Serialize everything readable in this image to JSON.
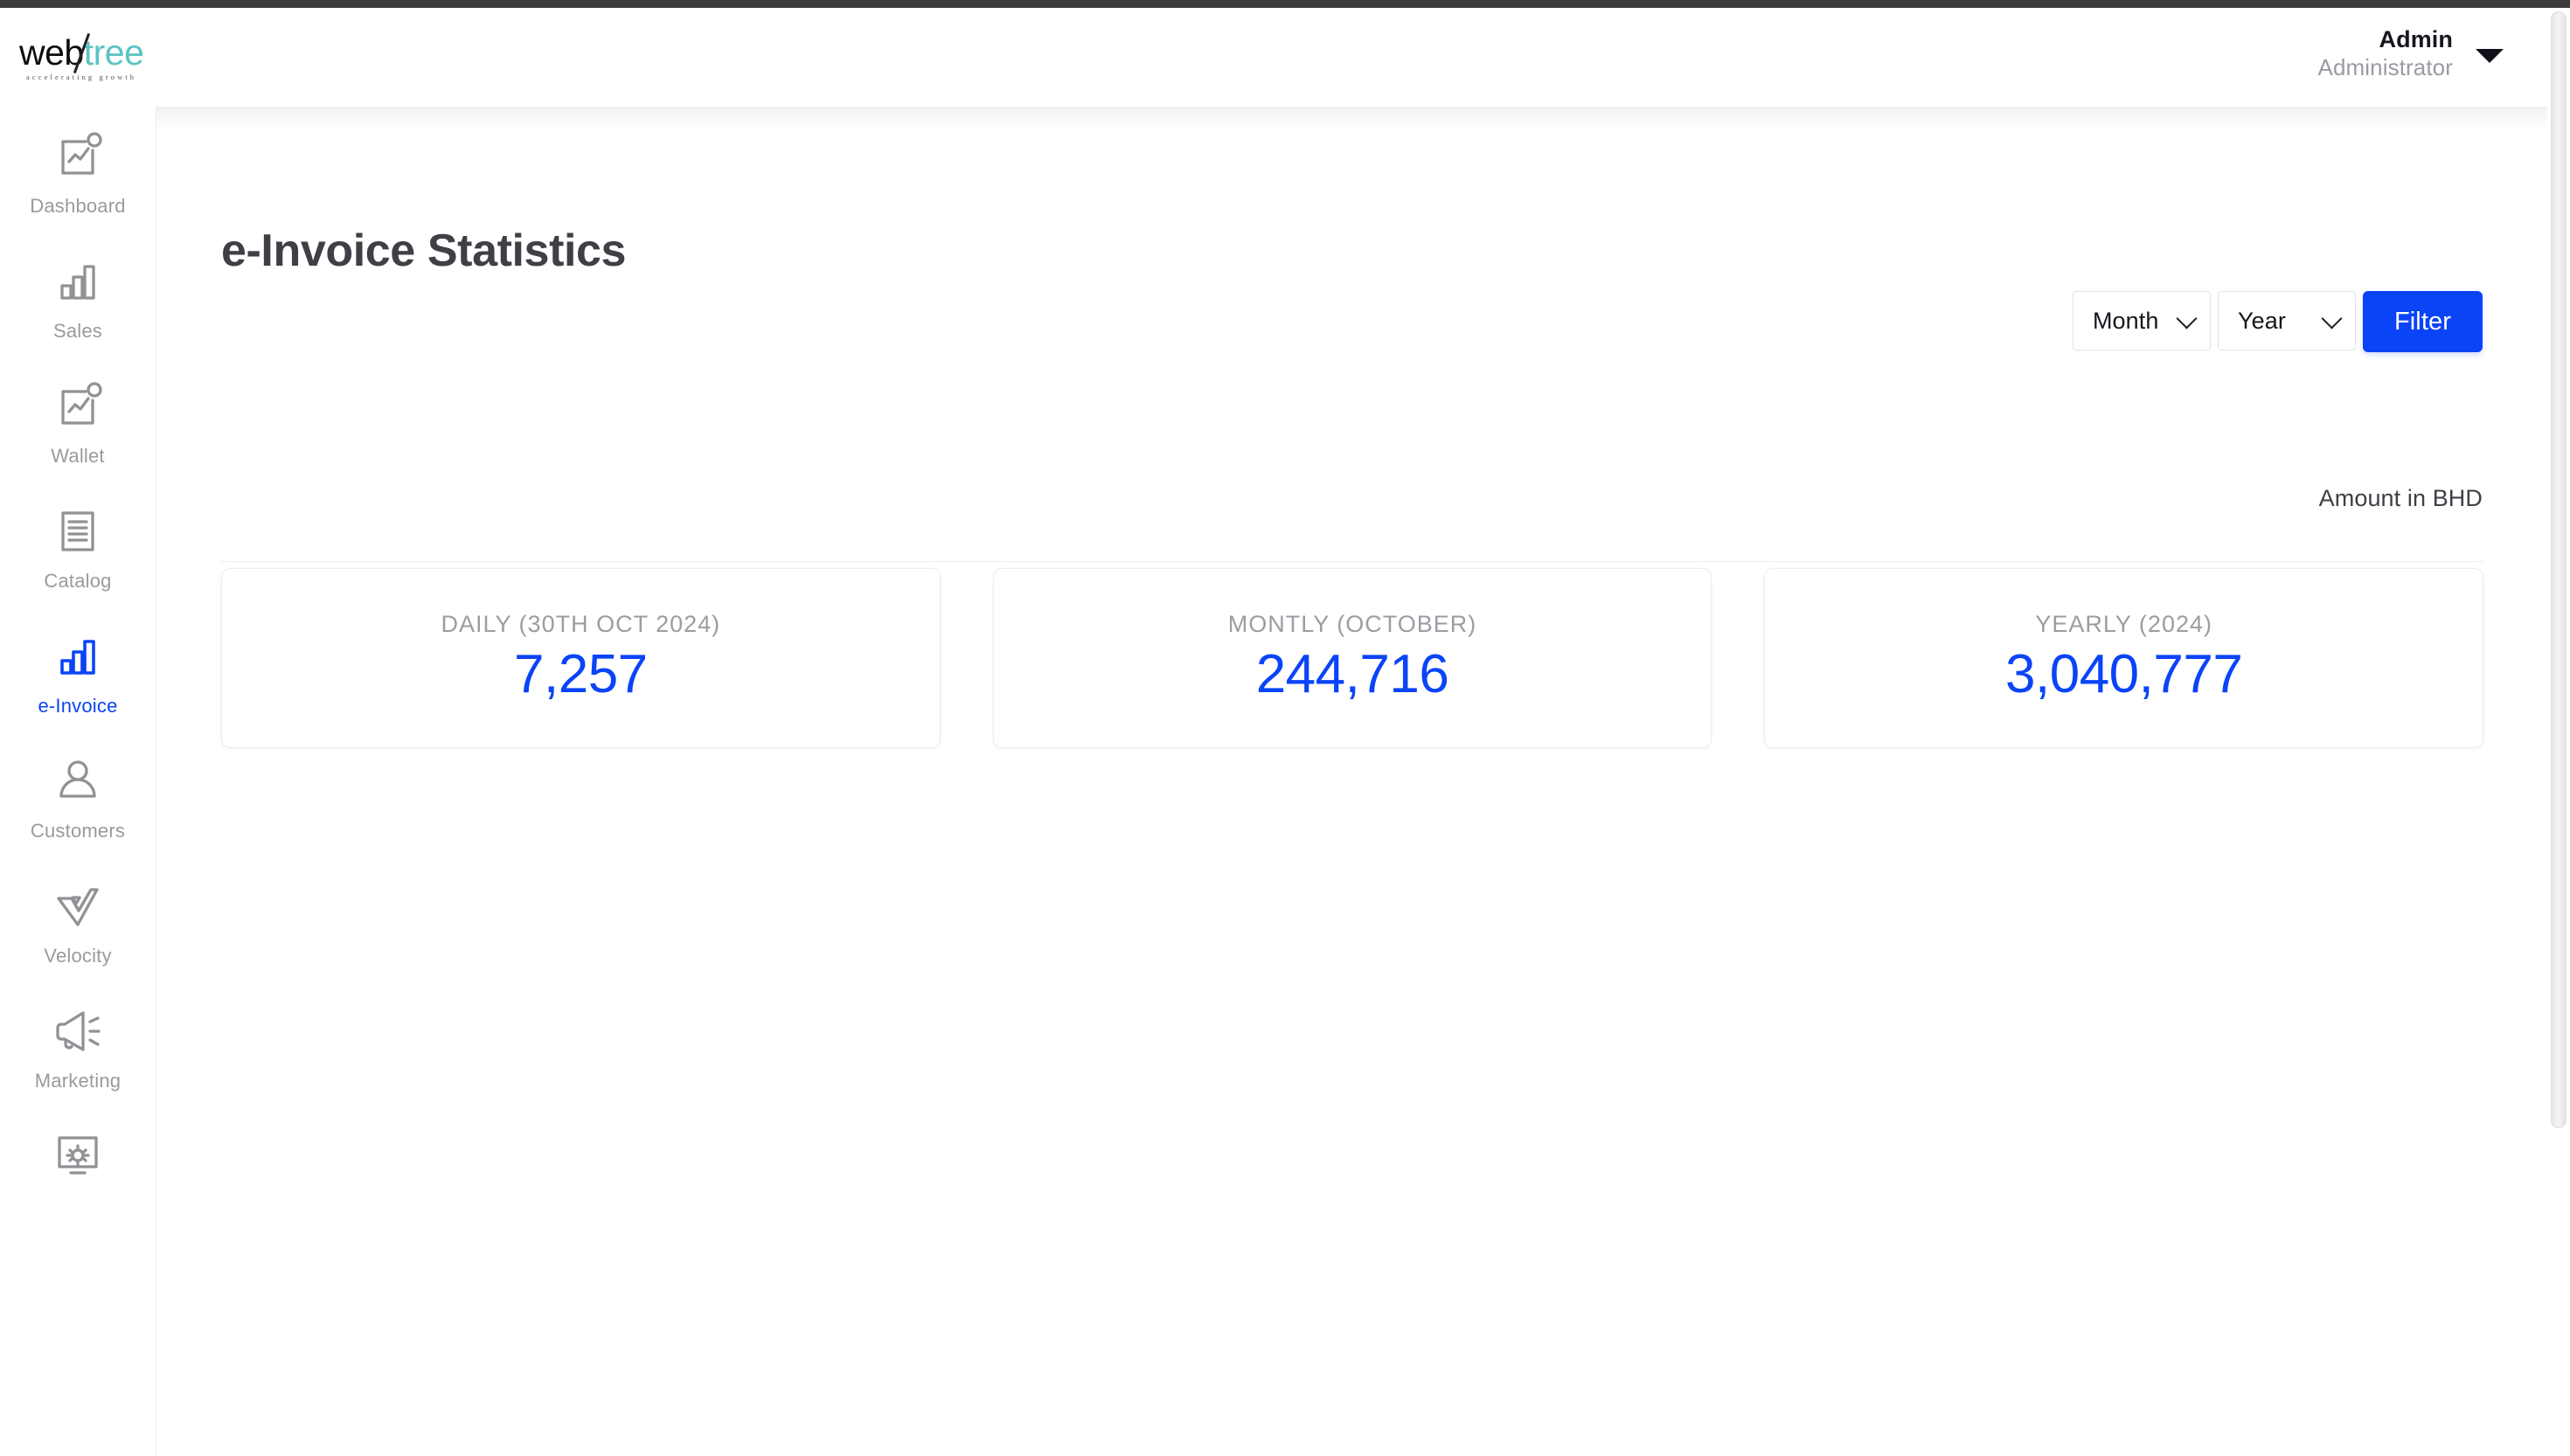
{
  "brand": {
    "logo_web": "web",
    "logo_tree": "tree",
    "tagline": "accelerating growth"
  },
  "header": {
    "account_name": "Admin",
    "account_role": "Administrator",
    "caret_icon": "caret-down-icon"
  },
  "sidebar": {
    "items": [
      {
        "label": "Dashboard",
        "icon": "chart-card-badge-icon",
        "active": false
      },
      {
        "label": "Sales",
        "icon": "bar-chart-icon",
        "active": false
      },
      {
        "label": "Wallet",
        "icon": "chart-card-badge-icon",
        "active": false
      },
      {
        "label": "Catalog",
        "icon": "document-lines-icon",
        "active": false
      },
      {
        "label": "e-Invoice",
        "icon": "bar-chart-icon",
        "active": true
      },
      {
        "label": "Customers",
        "icon": "user-icon",
        "active": false
      },
      {
        "label": "Velocity",
        "icon": "velocity-check-icon",
        "active": false
      },
      {
        "label": "Marketing",
        "icon": "megaphone-icon",
        "active": false
      },
      {
        "label": "",
        "icon": "monitor-gear-icon",
        "active": false
      }
    ]
  },
  "main": {
    "title": "e-Invoice Statistics",
    "filters": {
      "month_label": "Month",
      "year_label": "Year",
      "filter_button": "Filter",
      "chevron_icon": "chevron-down-icon"
    },
    "currency_note": "Amount in BHD",
    "cards": [
      {
        "label": "DAILY (30TH OCT 2024)",
        "value": "7,257"
      },
      {
        "label": "MONTLY (OCTOBER)",
        "value": "244,716"
      },
      {
        "label": "YEARLY (2024)",
        "value": "3,040,777"
      }
    ]
  },
  "colors": {
    "accent_blue": "#0b44f7",
    "muted_gray": "#9a9a9f",
    "title_gray": "#3f3f46",
    "logo_teal": "#5cc3c3"
  }
}
